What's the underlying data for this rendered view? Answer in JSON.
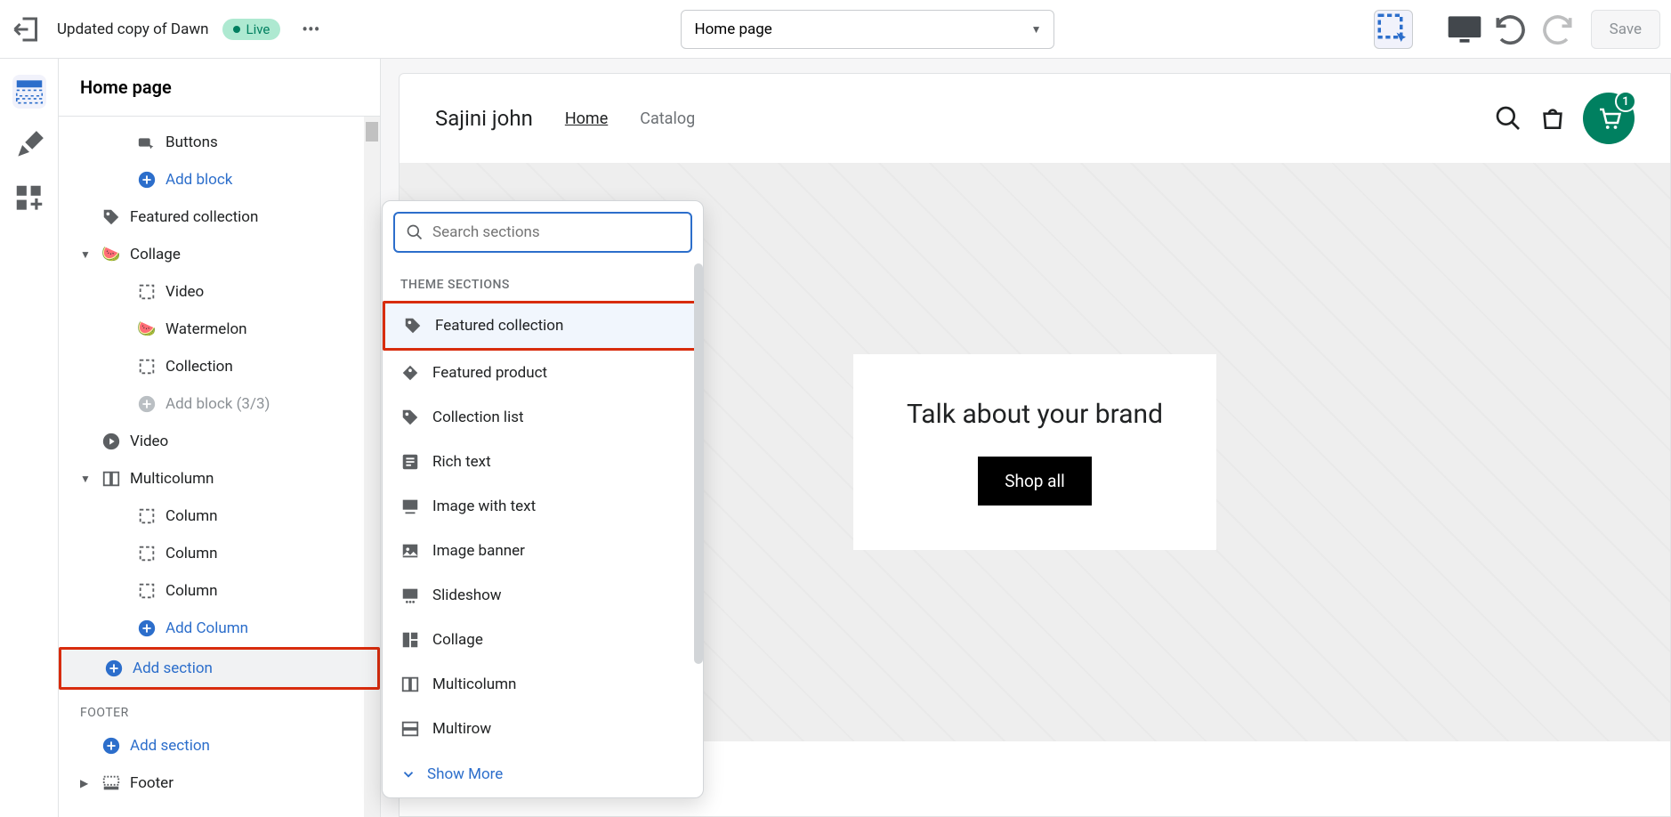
{
  "top": {
    "themeName": "Updated copy of Dawn",
    "liveBadge": "Live",
    "pageSelect": "Home page",
    "saveLabel": "Save"
  },
  "sidebar": {
    "title": "Home page",
    "items": {
      "buttons": "Buttons",
      "addBlock": "Add block",
      "featuredCollection": "Featured collection",
      "collage": "Collage",
      "video": "Video",
      "watermelon": "Watermelon",
      "collection": "Collection",
      "addBlockCount": "Add block (3/3)",
      "videoSection": "Video",
      "multicolumn": "Multicolumn",
      "column1": "Column",
      "column2": "Column",
      "column3": "Column",
      "addColumn": "Add Column",
      "addSection": "Add section",
      "footerHeading": "FOOTER",
      "footerAddSection": "Add section",
      "footer": "Footer"
    }
  },
  "popup": {
    "searchPlaceholder": "Search sections",
    "heading": "THEME SECTIONS",
    "items": [
      "Featured collection",
      "Featured product",
      "Collection list",
      "Rich text",
      "Image with text",
      "Image banner",
      "Slideshow",
      "Collage",
      "Multicolumn",
      "Multirow"
    ],
    "showMore": "Show More"
  },
  "preview": {
    "storeName": "Sajini john",
    "nav": {
      "home": "Home",
      "catalog": "Catalog"
    },
    "cartCount": "1",
    "heroTitle": "Talk about your brand",
    "heroButton": "Shop all"
  }
}
